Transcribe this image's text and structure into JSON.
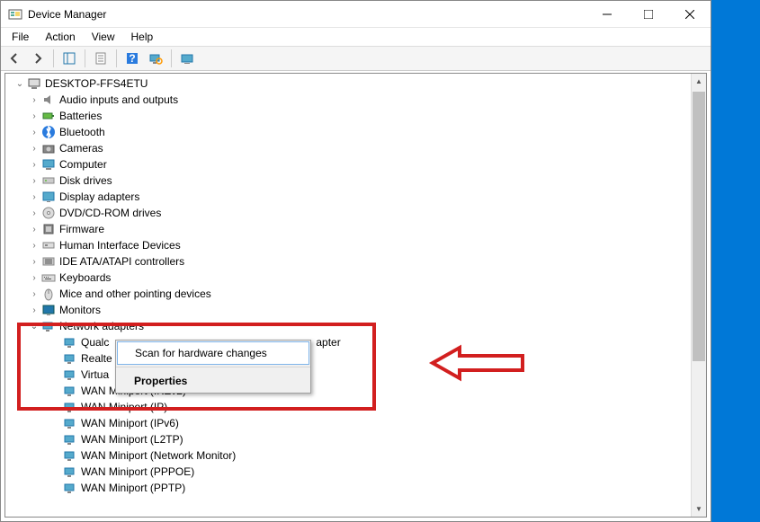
{
  "titlebar": {
    "title": "Device Manager"
  },
  "menubar": [
    "File",
    "Action",
    "View",
    "Help"
  ],
  "root": {
    "name": "DESKTOP-FFS4ETU"
  },
  "categories": [
    {
      "label": "Audio inputs and outputs",
      "icon": "audio"
    },
    {
      "label": "Batteries",
      "icon": "battery"
    },
    {
      "label": "Bluetooth",
      "icon": "bluetooth"
    },
    {
      "label": "Cameras",
      "icon": "camera"
    },
    {
      "label": "Computer",
      "icon": "computer"
    },
    {
      "label": "Disk drives",
      "icon": "disk"
    },
    {
      "label": "Display adapters",
      "icon": "display"
    },
    {
      "label": "DVD/CD-ROM drives",
      "icon": "dvd"
    },
    {
      "label": "Firmware",
      "icon": "firmware"
    },
    {
      "label": "Human Interface Devices",
      "icon": "hid"
    },
    {
      "label": "IDE ATA/ATAPI controllers",
      "icon": "ide"
    },
    {
      "label": "Keyboards",
      "icon": "keyboard"
    },
    {
      "label": "Mice and other pointing devices",
      "icon": "mouse"
    },
    {
      "label": "Monitors",
      "icon": "monitor"
    }
  ],
  "network": {
    "label": "Network adapters",
    "expanded": true,
    "children": [
      {
        "label_prefix": "Qualc",
        "label_suffix": "apter"
      },
      {
        "label_prefix": "Realte"
      },
      {
        "label_prefix": "Virtua"
      },
      {
        "label": "WAN Miniport (IKEv2)"
      },
      {
        "label": "WAN Miniport (IP)"
      },
      {
        "label": "WAN Miniport (IPv6)"
      },
      {
        "label": "WAN Miniport (L2TP)"
      },
      {
        "label": "WAN Miniport (Network Monitor)"
      },
      {
        "label": "WAN Miniport (PPPOE)"
      },
      {
        "label": "WAN Miniport (PPTP)"
      }
    ]
  },
  "context_menu": {
    "scan": "Scan for hardware changes",
    "props": "Properties"
  }
}
